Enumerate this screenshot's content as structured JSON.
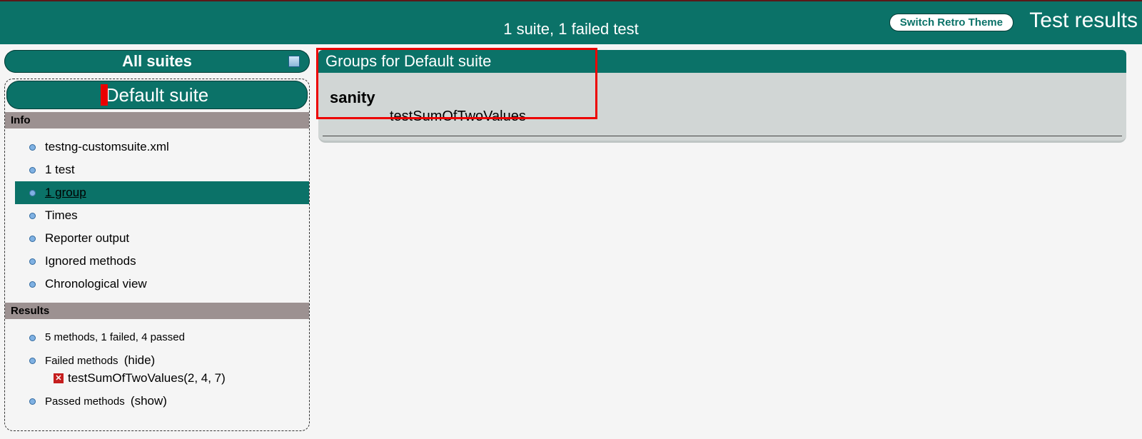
{
  "topbar": {
    "summary": "1 suite, 1 failed test",
    "switch_label": "Switch Retro Theme",
    "title": "Test results"
  },
  "left": {
    "all_suites": "All suites",
    "default_suite": "Default suite",
    "info_header": "Info",
    "info_items": [
      "testng-customsuite.xml",
      "1 test",
      "1 group",
      "Times",
      "Reporter output",
      "Ignored methods",
      "Chronological view"
    ],
    "results_header": "Results",
    "results": {
      "summary_line": "5 methods, 1 failed, 4 passed",
      "failed_label": "Failed methods",
      "hide": "(hide)",
      "failed_item": "testSumOfTwoValues(2, 4, 7)",
      "passed_label": "Passed methods",
      "show": "(show)"
    }
  },
  "right": {
    "header": "Groups for Default suite",
    "group_name": "sanity",
    "method": "testSumOfTwoValues"
  }
}
